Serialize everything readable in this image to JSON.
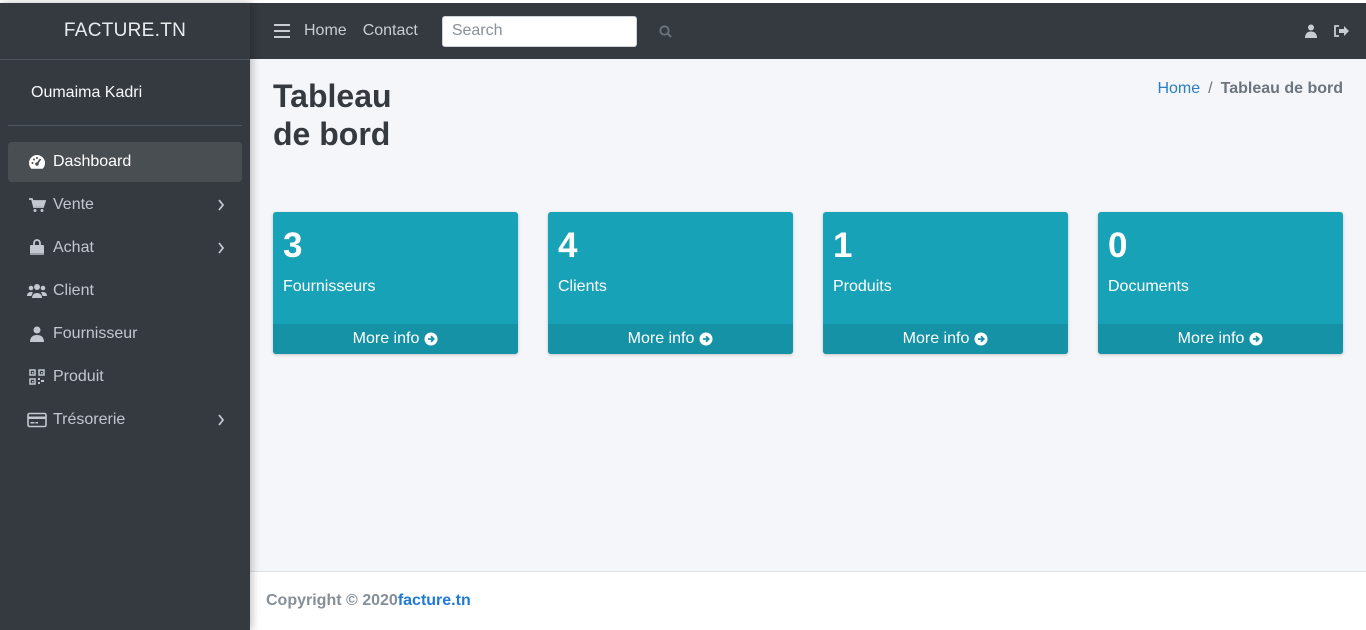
{
  "brand": "FACTURE.TN",
  "user": {
    "name": "Oumaima Kadri"
  },
  "sidebar": {
    "items": [
      {
        "label": "Dashboard",
        "icon": "dashboard-icon",
        "active": true,
        "submenu": false
      },
      {
        "label": "Vente",
        "icon": "cart-icon",
        "active": false,
        "submenu": true
      },
      {
        "label": "Achat",
        "icon": "bag-icon",
        "active": false,
        "submenu": true
      },
      {
        "label": "Client",
        "icon": "users-icon",
        "active": false,
        "submenu": false
      },
      {
        "label": "Fournisseur",
        "icon": "user-icon",
        "active": false,
        "submenu": false
      },
      {
        "label": "Produit",
        "icon": "qrcode-icon",
        "active": false,
        "submenu": false
      },
      {
        "label": "Trésorerie",
        "icon": "credit-card-icon",
        "active": false,
        "submenu": true
      }
    ]
  },
  "navbar": {
    "links": [
      "Home",
      "Contact"
    ],
    "search_placeholder": "Search"
  },
  "page": {
    "title": "Tableau de bord",
    "breadcrumb": {
      "home": "Home",
      "separator": "/",
      "current": "Tableau de bord"
    }
  },
  "boxes": [
    {
      "number": "3",
      "label": "Fournisseurs",
      "link": "More info"
    },
    {
      "number": "4",
      "label": "Clients",
      "link": "More info"
    },
    {
      "number": "1",
      "label": "Produits",
      "link": "More info"
    },
    {
      "number": "0",
      "label": "Documents",
      "link": "More info"
    }
  ],
  "footer": {
    "copyright": "Copyright © 2020",
    "link": "facture.tn"
  },
  "colors": {
    "sidebar": "#343a40",
    "info_box": "#17a2b8",
    "link": "#1f7ad6"
  }
}
